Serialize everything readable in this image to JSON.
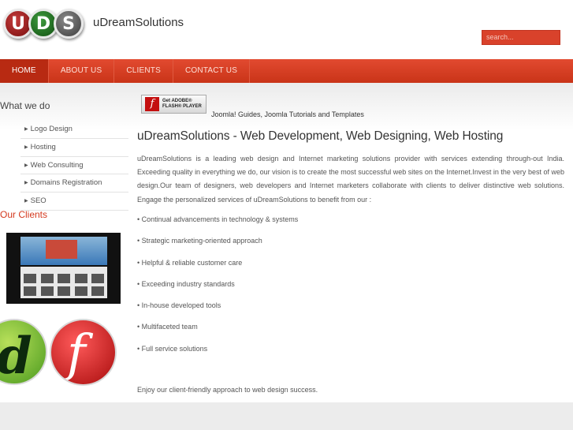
{
  "header": {
    "logo_letters": [
      "U",
      "D",
      "S"
    ],
    "site_name": "uDreamSolutions",
    "search_placeholder": "search..."
  },
  "nav": {
    "items": [
      {
        "label": "HOME",
        "active": true
      },
      {
        "label": "ABOUT US",
        "active": false
      },
      {
        "label": "CLIENTS",
        "active": false
      },
      {
        "label": "CONTACT US",
        "active": false
      }
    ]
  },
  "sidebar": {
    "title": "What we do",
    "items": [
      "Logo Design",
      "Hosting",
      "Web Consulting",
      "Domains Registration",
      "SEO"
    ],
    "clients_title": "Our Clients"
  },
  "main": {
    "flash_badge": {
      "line1": "Get ADOBE®",
      "line2": "FLASH® PLAYER"
    },
    "guides_text": "Joomla! Guides, Joomla Tutorials and Templates",
    "title": "uDreamSolutions - Web Development, Web Designing, Web Hosting",
    "intro": "uDreamSolutions is a leading web design and Internet marketing solutions provider with services extending through-out India. Exceeding quality in everything we do, our vision is to create the most successful web sites on the Internet.Invest in the very best of web design.Our team of designers, web developers and Internet marketers collaborate with clients to deliver distinctive web solutions. Engage the personalized services of uDreamSolutions to benefit from our :",
    "bullets": [
      "• Continual advancements in technology & systems",
      "• Strategic marketing-oriented approach",
      "• Helpful & reliable customer care",
      "• Exceeding industry standards",
      "• In-house developed tools",
      "• Multifaceted team",
      "• Full service solutions"
    ],
    "closing": "Enjoy our client-friendly approach to web design success."
  },
  "colors": {
    "accent": "#d4391e",
    "nav_active": "#b82a12"
  }
}
